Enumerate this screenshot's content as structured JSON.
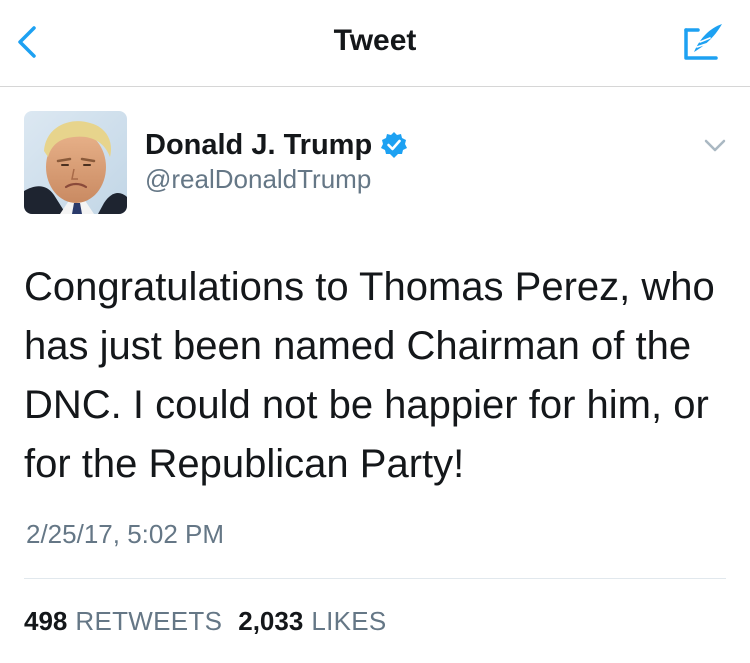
{
  "navbar": {
    "title": "Tweet",
    "back_icon": "chevron-left-icon",
    "compose_icon": "compose-quill-icon",
    "accent_color": "#1da1f2"
  },
  "tweet": {
    "author": {
      "name": "Donald J. Trump",
      "handle": "@realDonaldTrump",
      "verified": true,
      "verified_color": "#1da1f2"
    },
    "text": "Congratulations to Thomas Perez, who has just been named Chairman of the DNC. I could not be happier for him, or for the Republican Party!",
    "timestamp": "2/25/17, 5:02 PM",
    "stats": {
      "retweets_count": "498",
      "retweets_label": "RETWEETS",
      "likes_count": "2,033",
      "likes_label": "LIKES"
    }
  }
}
